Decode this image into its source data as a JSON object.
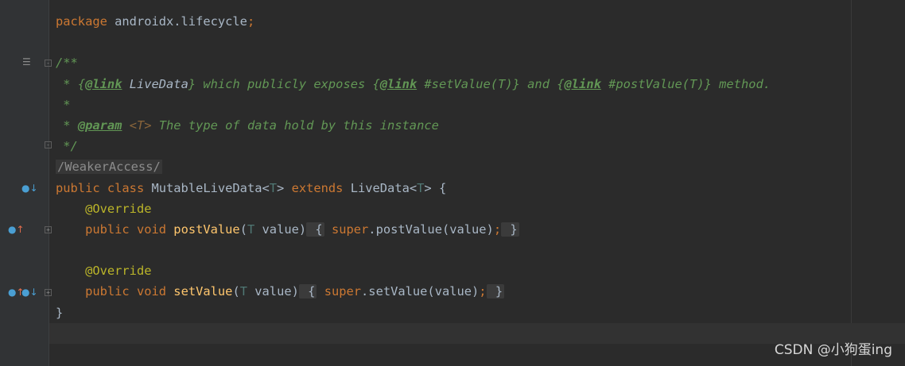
{
  "code": {
    "package_kw": "package",
    "package_name": " androidx.lifecycle",
    "semicolon": ";",
    "doc_open": "/**",
    "doc_star": " * ",
    "link_open": "{",
    "link_tag": "@link",
    "link_livedata": " LiveData",
    "link_close": "}",
    "doc_which": " which publicly exposes ",
    "link_setvalue": " #setValue(T)",
    "doc_and": " and ",
    "link_postvalue": " #postValue(T)",
    "doc_method": " method.",
    "doc_star_only": " *",
    "param_tag": "@param",
    "param_t": " <T>",
    "param_desc": " The type of data hold by this instance",
    "doc_close": " */",
    "weaker_access": "/WeakerAccess/",
    "public_kw": "public",
    "class_kw": " class",
    "class_name": " MutableLiveData<",
    "type_t": "T",
    "class_gt": ">",
    "extends_kw": " extends",
    "super_name": " LiveData<",
    "brace_open": " {",
    "indent": "    ",
    "override": "@Override",
    "void_kw": " void",
    "post_fn": " postValue",
    "set_fn": " setValue",
    "paren_open": "(",
    "param_value": " value)",
    "fold_open": " {",
    "super_kw": " super",
    "post_call": ".postValue(value)",
    "set_call": ".setValue(value)",
    "fold_close": " }",
    "class_close": "}"
  },
  "watermark": "CSDN @小狗蛋ing",
  "colors": {
    "background": "#2b2b2b",
    "gutter": "#313335",
    "keyword": "#cc7832",
    "function": "#ffc66d",
    "annotation": "#bbb529",
    "doc_comment": "#629755",
    "type_param": "#507874"
  },
  "gutter_icons": {
    "doc_toggle": "align-left-icon",
    "class_override_down": "implemented-down-icon",
    "method_override_up": "overrides-up-icon"
  }
}
